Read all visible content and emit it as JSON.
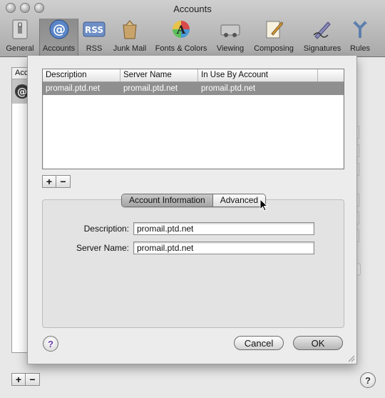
{
  "window": {
    "title": "Accounts"
  },
  "toolbar": {
    "items": [
      {
        "label": "General",
        "icon": "general-icon"
      },
      {
        "label": "Accounts",
        "icon": "accounts-at-icon",
        "selected": true
      },
      {
        "label": "RSS",
        "icon": "rss-icon"
      },
      {
        "label": "Junk Mail",
        "icon": "junk-mail-icon"
      },
      {
        "label": "Fonts & Colors",
        "icon": "fonts-colors-icon"
      },
      {
        "label": "Viewing",
        "icon": "viewing-icon"
      },
      {
        "label": "Composing",
        "icon": "composing-icon"
      },
      {
        "label": "Signatures",
        "icon": "signatures-icon"
      },
      {
        "label": "Rules",
        "icon": "rules-icon"
      }
    ]
  },
  "background": {
    "list_header": "Acc",
    "plus": "+",
    "minus": "−",
    "help": "?"
  },
  "sheet": {
    "table": {
      "columns": [
        "Description",
        "Server Name",
        "In Use By Account",
        ""
      ],
      "rows": [
        [
          "promail.ptd.net",
          "promail.ptd.net",
          "promail.ptd.net",
          ""
        ]
      ]
    },
    "plus": "+",
    "minus": "−",
    "tabs": {
      "account_information": "Account Information",
      "advanced": "Advanced",
      "selected": "Account Information"
    },
    "fields": {
      "description": {
        "label": "Description:",
        "value": "promail.ptd.net"
      },
      "server_name": {
        "label": "Server Name:",
        "value": "promail.ptd.net"
      }
    },
    "help": "?",
    "cancel_label": "Cancel",
    "ok_label": "OK"
  },
  "colors": {
    "selection_row": "#8f8f8f",
    "toolbar_selected": "#8c8c8c",
    "help_icon": "#6a3aa8"
  }
}
